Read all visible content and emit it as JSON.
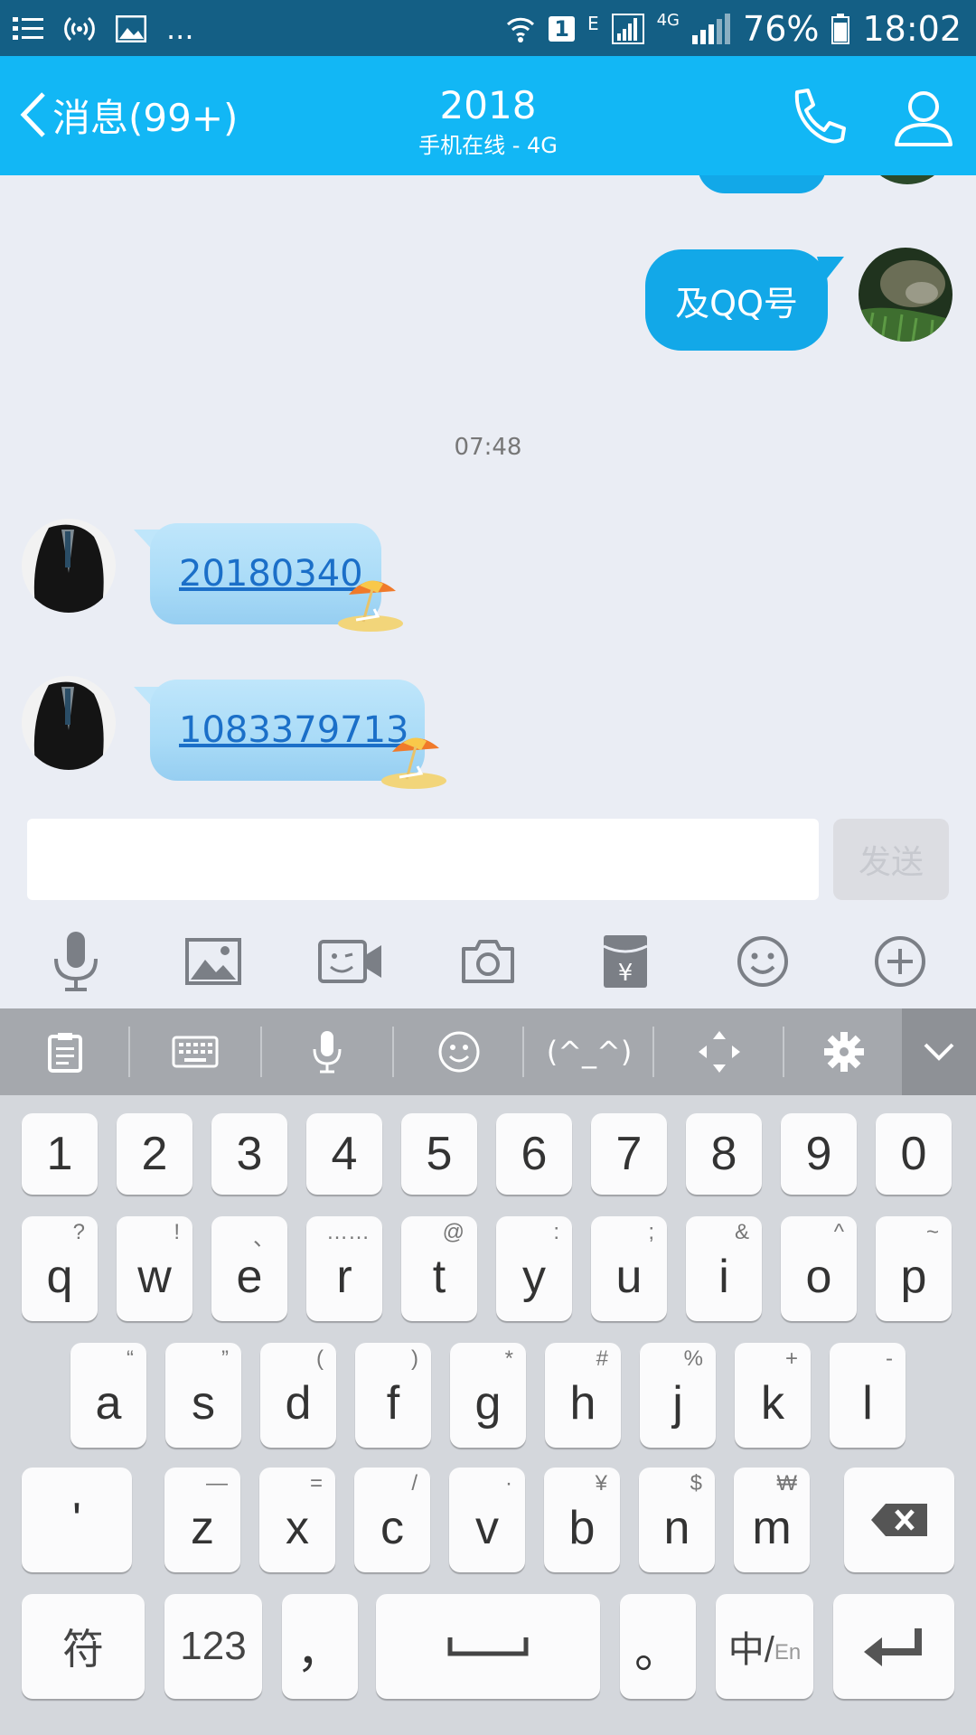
{
  "status_bar": {
    "dots": "...",
    "sim_slot": "1",
    "net_e": "E",
    "net_4g": "4G",
    "battery": "76%",
    "time": "18:02"
  },
  "header": {
    "back_label": "消息(99+)",
    "title": "2018",
    "subtitle": "手机在线 - 4G"
  },
  "chat": {
    "outgoing_message": "及QQ号",
    "timestamp": "07:48",
    "incoming": [
      {
        "text": "20180340"
      },
      {
        "text": "1083379713"
      }
    ]
  },
  "input": {
    "value": "",
    "send_label": "发送"
  },
  "toolbar_icons": [
    "mic-icon",
    "image-icon",
    "video-icon",
    "camera-icon",
    "red-packet-icon",
    "emoji-icon",
    "plus-icon"
  ],
  "red_packet_symbol": "¥",
  "keyboard_toolbar": {
    "kaomoji": "(^_^)"
  },
  "keyboard": {
    "row1": [
      "1",
      "2",
      "3",
      "4",
      "5",
      "6",
      "7",
      "8",
      "9",
      "0"
    ],
    "row2": [
      {
        "k": "q",
        "s": "?"
      },
      {
        "k": "w",
        "s": "!"
      },
      {
        "k": "e",
        "s": "、"
      },
      {
        "k": "r",
        "s": "……"
      },
      {
        "k": "t",
        "s": "@"
      },
      {
        "k": "y",
        "s": ":"
      },
      {
        "k": "u",
        "s": ";"
      },
      {
        "k": "i",
        "s": "&"
      },
      {
        "k": "o",
        "s": "^"
      },
      {
        "k": "p",
        "s": "~"
      }
    ],
    "row3": [
      {
        "k": "a",
        "s": "“"
      },
      {
        "k": "s",
        "s": "”"
      },
      {
        "k": "d",
        "s": "("
      },
      {
        "k": "f",
        "s": ")"
      },
      {
        "k": "g",
        "s": "*"
      },
      {
        "k": "h",
        "s": "#"
      },
      {
        "k": "j",
        "s": "%"
      },
      {
        "k": "k",
        "s": "+"
      },
      {
        "k": "l",
        "s": "-"
      }
    ],
    "apostrophe": "'",
    "row4": [
      {
        "k": "z",
        "s": "—"
      },
      {
        "k": "x",
        "s": "="
      },
      {
        "k": "c",
        "s": "/"
      },
      {
        "k": "v",
        "s": "·"
      },
      {
        "k": "b",
        "s": "¥"
      },
      {
        "k": "n",
        "s": "$"
      },
      {
        "k": "m",
        "s": "₩"
      }
    ],
    "symbols": "符",
    "numbers": "123",
    "comma": "，",
    "period": "。",
    "lang_zh": "中/",
    "lang_en": "En"
  },
  "colors": {
    "header": "#12b7f5",
    "status_bar": "#145f85",
    "outgoing_bubble": "#12a8e8",
    "link": "#1b6fc8"
  }
}
